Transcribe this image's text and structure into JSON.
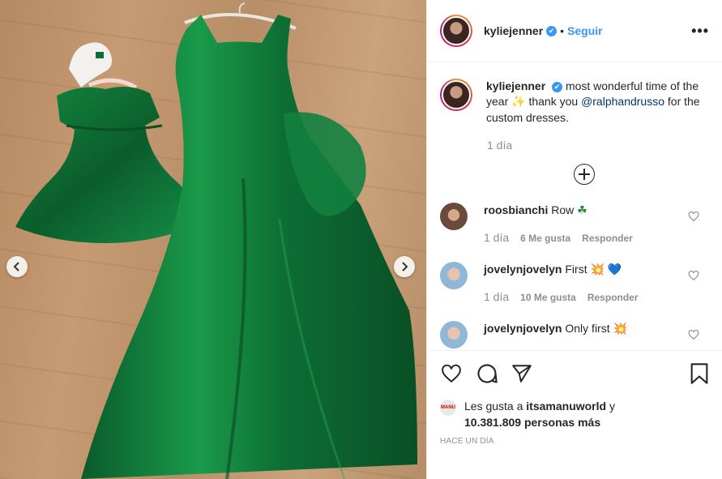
{
  "post": {
    "author": "kyliejenner",
    "verified_mark": "✔",
    "separator": "•",
    "follow_label": "Seguir",
    "more_label": "•••",
    "caption": {
      "username": "kyliejenner",
      "text_1": "most wonderful time of the year",
      "emoji_1": "✨",
      "text_2": "thank you",
      "mention": "@ralphandrusso",
      "text_3": "for the custom dresses."
    },
    "caption_time": "1 día",
    "comments": [
      {
        "username": "roosbianchi",
        "text": "Row",
        "emoji": "☘",
        "time": "1 día",
        "likes": "6 Me gusta",
        "reply": "Responder"
      },
      {
        "username": "jovelynjovelyn",
        "text": "First",
        "emoji": "💥",
        "emoji_2": "💙",
        "time": "1 día",
        "likes": "10 Me gusta",
        "reply": "Responder"
      },
      {
        "username": "jovelynjovelyn",
        "text": "Only first",
        "emoji": "💥"
      }
    ],
    "liked_by": {
      "prefix": "Les gusta a",
      "user": "itsamanuworld",
      "joiner": "y",
      "count": "10.381.809",
      "suffix": "personas más",
      "avatar_text": "MANU"
    },
    "timestamp": "Hace un día"
  },
  "icons": {
    "like": "heart-icon",
    "comment": "comment-icon",
    "share": "share-icon",
    "save": "bookmark-icon",
    "prev": "chevron-left-icon",
    "next": "chevron-right-icon"
  },
  "colors": {
    "link_blue": "#3897f0",
    "mention": "#003569",
    "muted": "#8e8e8e",
    "dress_green": "#0f7a3a"
  }
}
